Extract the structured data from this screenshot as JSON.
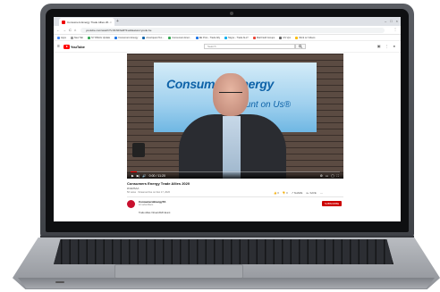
{
  "browser": {
    "tab_title": "Consumers Energy Trade Allies 20...",
    "tab_close": "×",
    "new_tab": "+",
    "window_controls": [
      "–",
      "□",
      "×"
    ],
    "nav": [
      "←",
      "→",
      "C",
      "⌂"
    ],
    "url": "youtube.com/watch?v=lhrNFfaMT1w&feature=youtu.be",
    "menu": "⋮",
    "bookmarks": [
      {
        "label": "Apps",
        "color": "#4285f4"
      },
      {
        "label": "New Tab",
        "color": "#999999"
      },
      {
        "label": "NY DMAG Update",
        "color": "#34a853"
      },
      {
        "label": "Consumers Energy",
        "color": "#1a73e8"
      },
      {
        "label": "Ameriquest Tec...",
        "color": "#0d62a8"
      },
      {
        "label": "Consumers Ener...",
        "color": "#34a853"
      },
      {
        "label": "EE Pros - Trade Ally",
        "color": "#1a73e8"
      },
      {
        "label": "Skype - Trade ALLY",
        "color": "#00aff0"
      },
      {
        "label": "Mail Field Groups",
        "color": "#ea4335"
      },
      {
        "label": "US Vpn",
        "color": "#666666"
      },
      {
        "label": "Work on Videos",
        "color": "#fbbc05"
      }
    ]
  },
  "youtube": {
    "menu_icon": "≡",
    "brand": "YouTube",
    "search_placeholder": "Search",
    "header_icons": [
      "▣",
      "⋮",
      "●"
    ],
    "player": {
      "screen_brand": "ConsumersEnergy",
      "screen_tagline": "Count on Us®",
      "progress_fraction": 0.03,
      "left_controls": [
        "▶",
        "▶|",
        "🔊",
        "0:00 / 11:20"
      ],
      "right_controls": [
        "⚙",
        "▭",
        "▢",
        "⛶"
      ]
    },
    "video_title": "Consumers Energy Trade Allies 2020",
    "hashtag": "#CEMSAA",
    "views": "50 views · Streamed live on Dec 17, 2020",
    "actions": [
      "👍 0",
      "👎 0",
      "↗ SHARE",
      "≡+ SAVE",
      "⋯"
    ],
    "channel": {
      "name": "ConsumersEnergyTA",
      "subs": "12 subscribers",
      "subscribe": "SUBSCRIBE"
    },
    "description": "Trade Allies Virtual 2020 Event"
  }
}
